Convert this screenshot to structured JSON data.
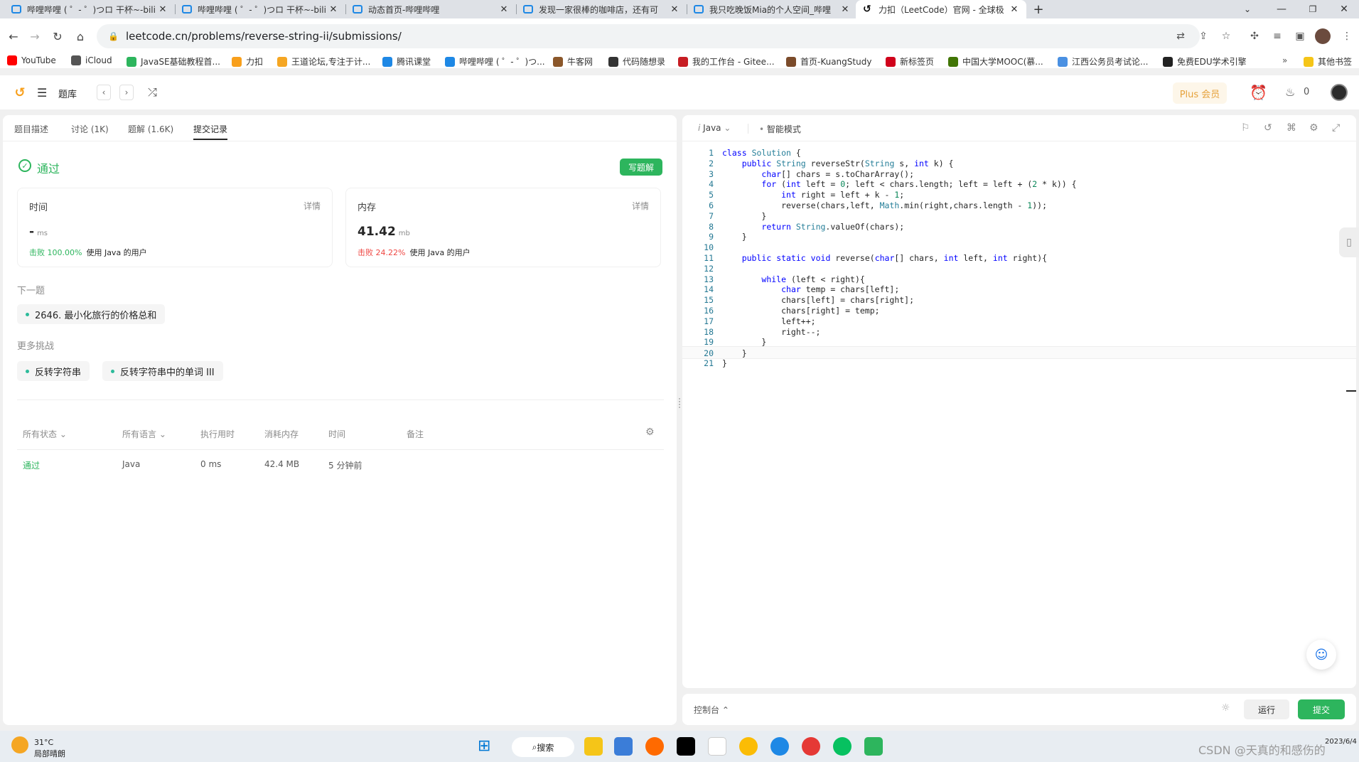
{
  "browser": {
    "tabs": [
      {
        "title": "哔哩哔哩 ( ゜- ゜)つロ 干杯~-bili"
      },
      {
        "title": "哔哩哔哩 ( ゜- ゜)つロ 干杯~-bili"
      },
      {
        "title": "动态首页-哔哩哔哩"
      },
      {
        "title": "发现一家很棒的咖啡店，还有可"
      },
      {
        "title": "我只吃晚饭Mia的个人空间_哔哩"
      },
      {
        "title": "力扣（LeetCode）官网 - 全球极"
      }
    ],
    "new_tab": "+",
    "url": "leetcode.cn/problems/reverse-string-ii/submissions/",
    "bookmarks": [
      {
        "label": "YouTube",
        "color": "#ff0000"
      },
      {
        "label": "iCloud",
        "color": "#555555"
      },
      {
        "label": "JavaSE基础教程首...",
        "color": "#2db55d"
      },
      {
        "label": "力扣",
        "color": "#f89f1b"
      },
      {
        "label": "王道论坛,专注于计...",
        "color": "#f5a623"
      },
      {
        "label": "腾讯课堂",
        "color": "#1e88e5"
      },
      {
        "label": "哔哩哔哩 ( ゜- ゜)つ...",
        "color": "#1e88e5"
      },
      {
        "label": "牛客网",
        "color": "#8b572a"
      },
      {
        "label": "代码随想录",
        "color": "#333333"
      },
      {
        "label": "我的工作台 - Gitee...",
        "color": "#c71d23"
      },
      {
        "label": "首页-KuangStudy",
        "color": "#7b4b2a"
      },
      {
        "label": "新标签页",
        "color": "#d0021b"
      },
      {
        "label": "中国大学MOOC(慕...",
        "color": "#417505"
      },
      {
        "label": "江西公务员考试论...",
        "color": "#4a90e2"
      },
      {
        "label": "免费EDU学术引擎",
        "color": "#222222"
      }
    ],
    "other_bookmarks": "其他书签"
  },
  "app": {
    "library": "题库",
    "plus": "Plus 会员",
    "streak": "0"
  },
  "left": {
    "tabs": [
      "题目描述",
      "讨论 (1K)",
      "题解 (1.6K)",
      "提交记录"
    ],
    "status": "通过",
    "write_solution": "写题解",
    "time_card": {
      "label": "时间",
      "detail": "详情",
      "value": "-",
      "unit": "ms",
      "beat": "击败 100.00%",
      "users": "使用 Java 的用户"
    },
    "mem_card": {
      "label": "内存",
      "detail": "详情",
      "value": "41.42",
      "unit": "mb",
      "beat": "击败 24.22%",
      "users": "使用 Java 的用户"
    },
    "next_label": "下一题",
    "next_problem": "2646. 最小化旅行的价格总和",
    "more_label": "更多挑战",
    "more": [
      "反转字符串",
      "反转字符串中的单词 III"
    ],
    "table": {
      "headers": [
        "所有状态",
        "所有语言",
        "执行用时",
        "消耗内存",
        "时间",
        "备注"
      ],
      "row": {
        "status": "通过",
        "lang": "Java",
        "time": "0 ms",
        "mem": "42.4 MB",
        "when": "5 分钟前"
      }
    }
  },
  "editor": {
    "lang": "Java",
    "mode": "智能模式",
    "lines": [
      "class Solution {",
      "    public String reverseStr(String s, int k) {",
      "        char[] chars = s.toCharArray();",
      "        for (int left = 0; left < chars.length; left = left + (2 * k)) {",
      "            int right = left + k - 1;",
      "            reverse(chars,left, Math.min(right,chars.length - 1));",
      "        }",
      "        return String.valueOf(chars);",
      "    }",
      "",
      "    public static void reverse(char[] chars, int left, int right){",
      "",
      "        while (left < right){",
      "            char temp = chars[left];",
      "            chars[left] = chars[right];",
      "            chars[right] = temp;",
      "            left++;",
      "            right--;",
      "        }",
      "    }",
      "}"
    ],
    "console": "控制台",
    "run": "运行",
    "submit": "提交"
  },
  "taskbar": {
    "temp": "31°C",
    "weather": "局部晴朗",
    "search": "搜索",
    "watermark": "CSDN @天真的和感伤的",
    "time": "2023/6/4"
  },
  "colors": {
    "accent": "#2db55d",
    "fail": "#ef4743",
    "plus": "#e6a23c"
  }
}
